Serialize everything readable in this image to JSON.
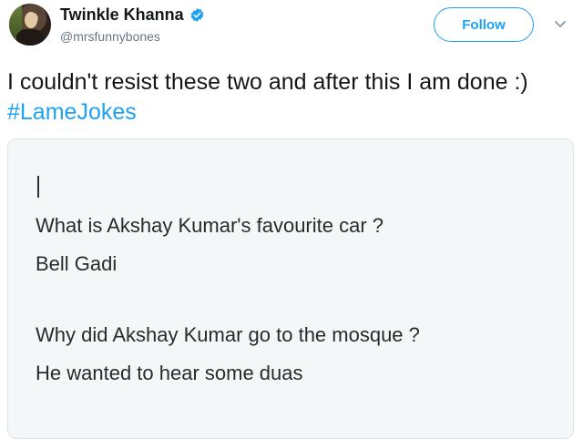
{
  "user": {
    "display_name": "Twinkle Khanna",
    "handle": "@mrsfunnybones",
    "verified_icon": "verified-badge-icon",
    "avatar_icon": "avatar"
  },
  "actions": {
    "follow_label": "Follow",
    "menu_icon": "chevron-down-icon"
  },
  "tweet": {
    "text_before_hashtag": "I couldn't resist these two and after this I am done :) ",
    "hashtag": "#LameJokes"
  },
  "image": {
    "lines": [
      "What is Akshay Kumar's favourite car ?",
      "Bell Gadi",
      "Why did Akshay Kumar go to the mosque ?",
      "He wanted to hear some duas"
    ]
  },
  "colors": {
    "accent": "#1da1f2",
    "text": "#14171a",
    "muted": "#657786",
    "card_bg": "#f5f6f7"
  }
}
